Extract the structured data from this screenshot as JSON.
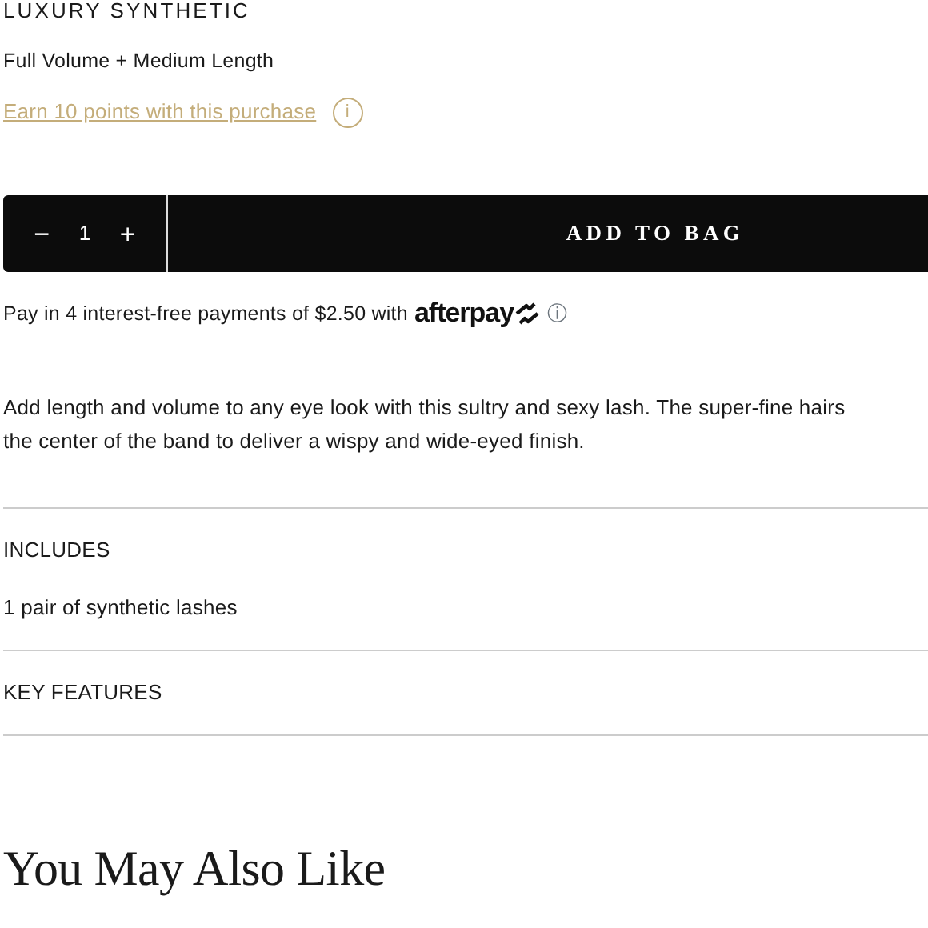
{
  "product": {
    "title": "LUXURY SYNTHETIC",
    "variant": "Full Volume + Medium Length",
    "points_link": "Earn 10 points with this purchase",
    "info_glyph": "i"
  },
  "purchase": {
    "decrement": "−",
    "quantity": "1",
    "increment": "+",
    "add_button": "ADD TO BAG"
  },
  "afterpay": {
    "text": "Pay in 4 interest-free payments of $2.50 with",
    "brand": "afterpay",
    "info_glyph": "ⓘ"
  },
  "description": [
    "Add length and volume to any eye look with this sultry and sexy lash. The super-fine hairs",
    "the center of the band to deliver a wispy and wide-eyed finish."
  ],
  "sections": [
    {
      "heading": "INCLUDES",
      "content": "1 pair of synthetic lashes"
    },
    {
      "heading": "KEY FEATURES"
    }
  ],
  "recommendations": {
    "heading": "You May Also Like"
  }
}
